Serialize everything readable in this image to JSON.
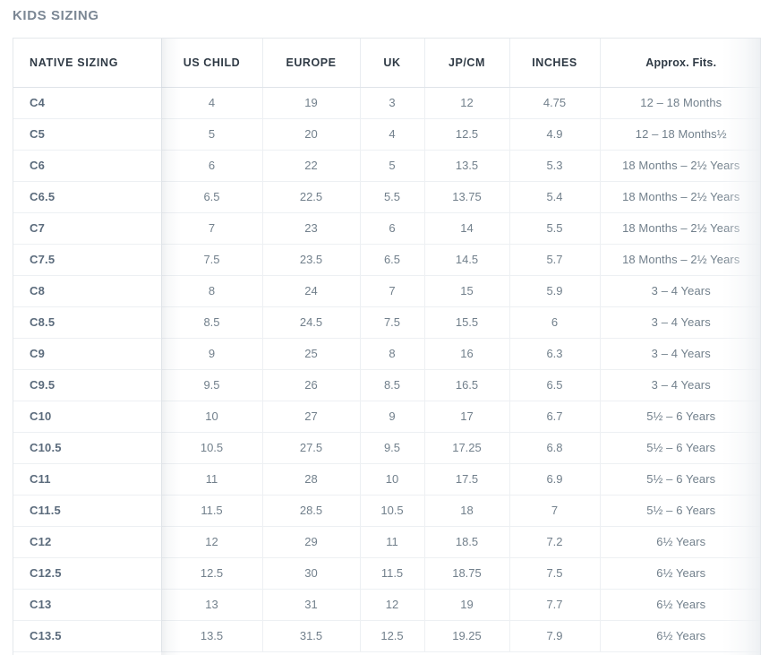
{
  "section": {
    "title": "KIDS SIZING"
  },
  "table": {
    "columns": [
      {
        "key": "native",
        "label": "NATIVE SIZING"
      },
      {
        "key": "uschild",
        "label": "US CHILD"
      },
      {
        "key": "europe",
        "label": "EUROPE"
      },
      {
        "key": "uk",
        "label": "UK"
      },
      {
        "key": "jpcm",
        "label": "JP/CM"
      },
      {
        "key": "inches",
        "label": "INCHES"
      },
      {
        "key": "fits",
        "label": "Approx. Fits."
      }
    ],
    "rows": [
      {
        "native": "C4",
        "uschild": "4",
        "europe": "19",
        "uk": "3",
        "jpcm": "12",
        "inches": "4.75",
        "fits": "12 – 18 Months"
      },
      {
        "native": "C5",
        "uschild": "5",
        "europe": "20",
        "uk": "4",
        "jpcm": "12.5",
        "inches": "4.9",
        "fits": "12 – 18 Months½"
      },
      {
        "native": "C6",
        "uschild": "6",
        "europe": "22",
        "uk": "5",
        "jpcm": "13.5",
        "inches": "5.3",
        "fits": "18 Months – 2½ Years"
      },
      {
        "native": "C6.5",
        "uschild": "6.5",
        "europe": "22.5",
        "uk": "5.5",
        "jpcm": "13.75",
        "inches": "5.4",
        "fits": "18 Months – 2½ Years"
      },
      {
        "native": "C7",
        "uschild": "7",
        "europe": "23",
        "uk": "6",
        "jpcm": "14",
        "inches": "5.5",
        "fits": "18 Months – 2½ Years"
      },
      {
        "native": "C7.5",
        "uschild": "7.5",
        "europe": "23.5",
        "uk": "6.5",
        "jpcm": "14.5",
        "inches": "5.7",
        "fits": "18 Months – 2½ Years"
      },
      {
        "native": "C8",
        "uschild": "8",
        "europe": "24",
        "uk": "7",
        "jpcm": "15",
        "inches": "5.9",
        "fits": "3 – 4 Years"
      },
      {
        "native": "C8.5",
        "uschild": "8.5",
        "europe": "24.5",
        "uk": "7.5",
        "jpcm": "15.5",
        "inches": "6",
        "fits": "3 – 4 Years"
      },
      {
        "native": "C9",
        "uschild": "9",
        "europe": "25",
        "uk": "8",
        "jpcm": "16",
        "inches": "6.3",
        "fits": "3 – 4 Years"
      },
      {
        "native": "C9.5",
        "uschild": "9.5",
        "europe": "26",
        "uk": "8.5",
        "jpcm": "16.5",
        "inches": "6.5",
        "fits": "3 – 4 Years"
      },
      {
        "native": "C10",
        "uschild": "10",
        "europe": "27",
        "uk": "9",
        "jpcm": "17",
        "inches": "6.7",
        "fits": "5½ – 6 Years"
      },
      {
        "native": "C10.5",
        "uschild": "10.5",
        "europe": "27.5",
        "uk": "9.5",
        "jpcm": "17.25",
        "inches": "6.8",
        "fits": "5½ – 6 Years"
      },
      {
        "native": "C11",
        "uschild": "11",
        "europe": "28",
        "uk": "10",
        "jpcm": "17.5",
        "inches": "6.9",
        "fits": "5½ – 6 Years"
      },
      {
        "native": "C11.5",
        "uschild": "11.5",
        "europe": "28.5",
        "uk": "10.5",
        "jpcm": "18",
        "inches": "7",
        "fits": "5½ – 6 Years"
      },
      {
        "native": "C12",
        "uschild": "12",
        "europe": "29",
        "uk": "11",
        "jpcm": "18.5",
        "inches": "7.2",
        "fits": "6½ Years"
      },
      {
        "native": "C12.5",
        "uschild": "12.5",
        "europe": "30",
        "uk": "11.5",
        "jpcm": "18.75",
        "inches": "7.5",
        "fits": "6½ Years"
      },
      {
        "native": "C13",
        "uschild": "13",
        "europe": "31",
        "uk": "12",
        "jpcm": "19",
        "inches": "7.7",
        "fits": "6½ Years"
      },
      {
        "native": "C13.5",
        "uschild": "13.5",
        "europe": "31.5",
        "uk": "12.5",
        "jpcm": "19.25",
        "inches": "7.9",
        "fits": "6½ Years"
      }
    ]
  },
  "colors": {
    "title": "#7b8794",
    "header_text": "#2f3a45",
    "native_text": "#5b6b7c",
    "cell_text": "#72808c",
    "border": "#e9edf1",
    "row_divider": "#edf0f3",
    "background": "#ffffff"
  }
}
